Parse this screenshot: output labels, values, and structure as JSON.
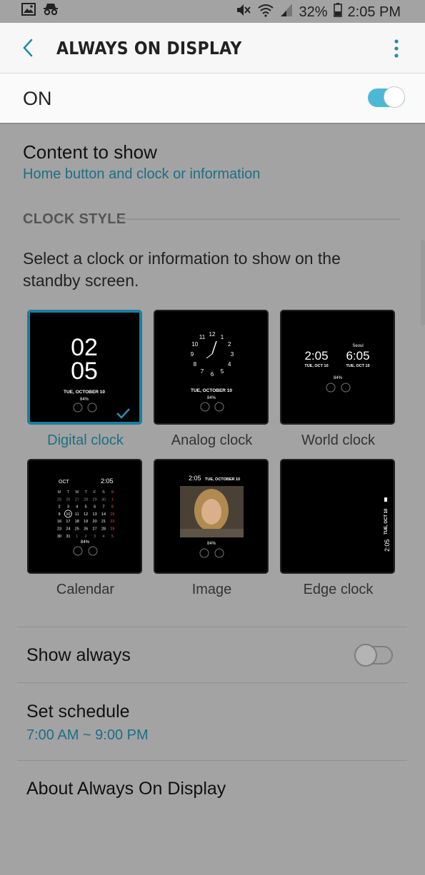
{
  "status_bar": {
    "battery": "32%",
    "time": "2:05 PM"
  },
  "header": {
    "title": "ALWAYS ON DISPLAY"
  },
  "master": {
    "label": "ON",
    "enabled": true
  },
  "content": {
    "title": "Content to show",
    "value": "Home button and clock or information"
  },
  "clock_style": {
    "heading": "CLOCK STYLE",
    "description": "Select a clock or information to show on the standby screen.",
    "selected": "Digital clock",
    "options": [
      "Digital clock",
      "Analog clock",
      "World clock",
      "Calendar",
      "Image",
      "Edge clock"
    ],
    "previews": {
      "digital_hour": "02",
      "digital_minute": "05",
      "date": "TUE, OCTOBER 10",
      "battery": "84%",
      "analog_numbers": [
        "12",
        "1",
        "2",
        "3",
        "4",
        "5",
        "6",
        "7",
        "8",
        "9",
        "10",
        "11"
      ],
      "world_city": "Seoul",
      "world_time_1": "2:05",
      "world_time_2": "6:05",
      "world_date": "TUE, OCT 10",
      "world_date_2": "TUE, OCT 10",
      "calendar_month": "OCT",
      "calendar_time": "2:05",
      "calendar_weekdays": [
        "M",
        "T",
        "W",
        "T",
        "F",
        "S",
        "S"
      ],
      "calendar_rows": [
        [
          "25",
          "26",
          "27",
          "28",
          "29",
          "30",
          "1"
        ],
        [
          "2",
          "3",
          "4",
          "5",
          "6",
          "7",
          "8"
        ],
        [
          "9",
          "10",
          "11",
          "12",
          "13",
          "14",
          "15"
        ],
        [
          "16",
          "17",
          "18",
          "19",
          "20",
          "21",
          "22"
        ],
        [
          "23",
          "24",
          "25",
          "26",
          "27",
          "28",
          "29"
        ],
        [
          "30",
          "31",
          "1",
          "2",
          "3",
          "4",
          "5"
        ]
      ],
      "image_time": "2:05",
      "image_date": "TUE, OCTOBER 10",
      "edge_date": "TUE, OCT 10",
      "edge_time": "2:05"
    }
  },
  "show_always": {
    "label": "Show always",
    "enabled": false
  },
  "schedule": {
    "label": "Set schedule",
    "value": "7:00 AM ~ 9:00 PM"
  },
  "about": {
    "label": "About Always On Display"
  },
  "colors": {
    "accent": "#4bb8d6",
    "link": "#1c6f86",
    "selected_border": "#1a7ea2"
  }
}
